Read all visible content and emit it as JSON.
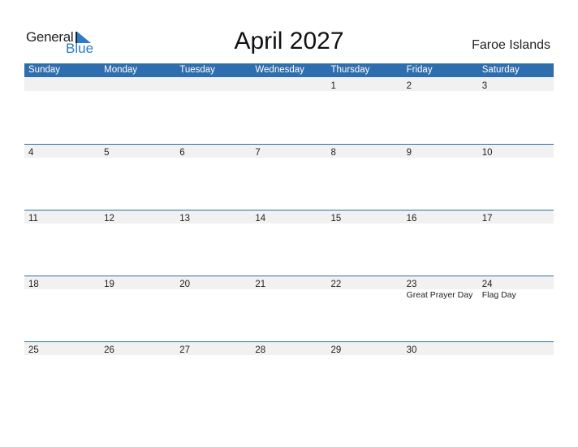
{
  "logo": {
    "word1": "General",
    "word2": "Blue"
  },
  "title": "April 2027",
  "country": "Faroe Islands",
  "colors": {
    "header": "#2f6eae",
    "logo_blue": "#2a7bc8",
    "date_row": "#f1f1f1"
  },
  "weekdays": [
    "Sunday",
    "Monday",
    "Tuesday",
    "Wednesday",
    "Thursday",
    "Friday",
    "Saturday"
  ],
  "weeks": [
    {
      "days": [
        "",
        "",
        "",
        "",
        "1",
        "2",
        "3"
      ],
      "events": [
        "",
        "",
        "",
        "",
        "",
        "",
        ""
      ]
    },
    {
      "days": [
        "4",
        "5",
        "6",
        "7",
        "8",
        "9",
        "10"
      ],
      "events": [
        "",
        "",
        "",
        "",
        "",
        "",
        ""
      ]
    },
    {
      "days": [
        "11",
        "12",
        "13",
        "14",
        "15",
        "16",
        "17"
      ],
      "events": [
        "",
        "",
        "",
        "",
        "",
        "",
        ""
      ]
    },
    {
      "days": [
        "18",
        "19",
        "20",
        "21",
        "22",
        "23",
        "24"
      ],
      "events": [
        "",
        "",
        "",
        "",
        "",
        "Great Prayer Day",
        "Flag Day"
      ]
    },
    {
      "days": [
        "25",
        "26",
        "27",
        "28",
        "29",
        "30",
        ""
      ],
      "events": [
        "",
        "",
        "",
        "",
        "",
        "",
        ""
      ]
    }
  ]
}
